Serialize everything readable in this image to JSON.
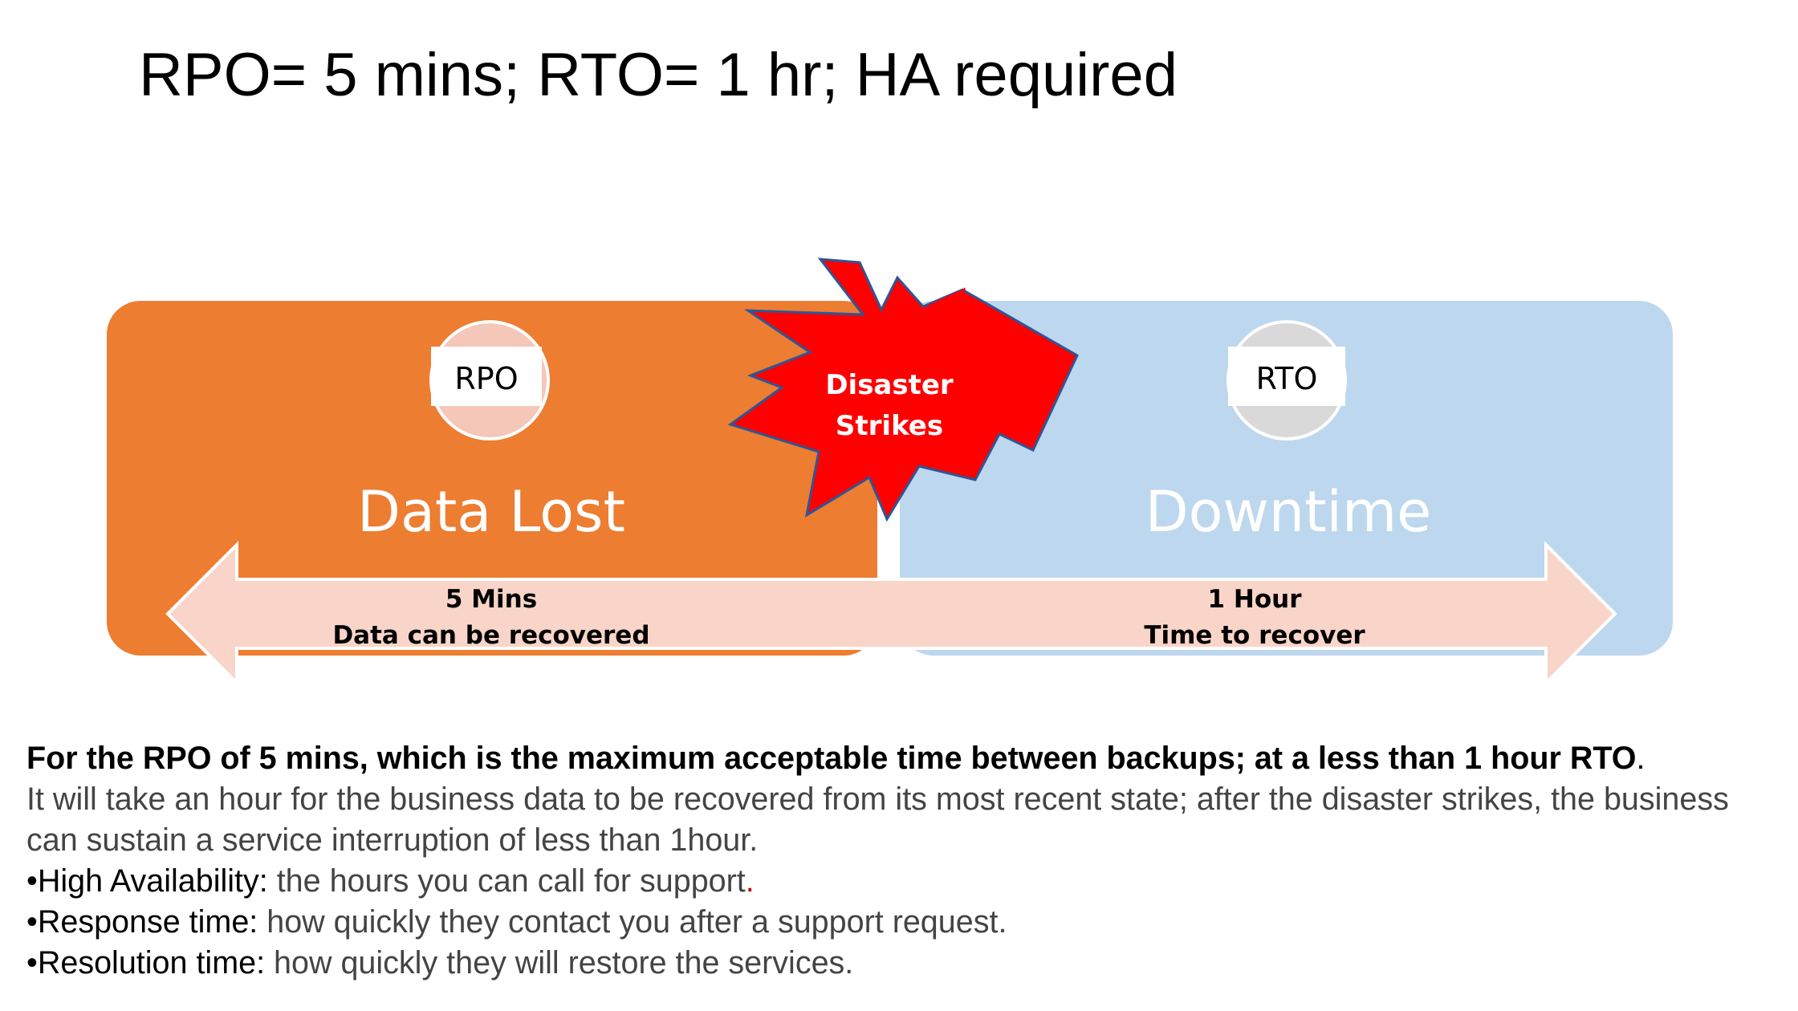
{
  "slide": {
    "title": "RPO= 5 mins; RTO= 1 hr; HA required"
  },
  "diagram": {
    "left_box": {
      "badge": "RPO",
      "label": "Data Lost",
      "color": "#ED7D31",
      "arrow_value": "5 Mins",
      "arrow_caption": "Data can be recovered"
    },
    "right_box": {
      "badge": "RTO",
      "label": "Downtime",
      "color": "#BDD7EE",
      "arrow_value": "1 Hour",
      "arrow_caption": "Time to recover"
    },
    "burst": {
      "line1": "Disaster",
      "line2": "Strikes",
      "color": "#FF0000",
      "outline": "#2F5597"
    },
    "arrow_color": "#F8D5C8"
  },
  "description": {
    "lead": "For the RPO of 5 mins, which is the maximum acceptable time between backups; at a less than 1 hour RTO",
    "lead_end": ".",
    "body": "It will take an hour for the business data to be recovered from its most recent state;  after the disaster strikes, the business can sustain a service interruption of less than 1hour.",
    "bullets": [
      {
        "term": "•High Availability:",
        "text": " the hours you can call for support",
        "end": "."
      },
      {
        "term": "•Response time:",
        "text": " how quickly they contact you after a support request.",
        "end": ""
      },
      {
        "term": "•Resolution time:",
        "text": " how quickly they will restore the services.",
        "end": ""
      }
    ]
  }
}
